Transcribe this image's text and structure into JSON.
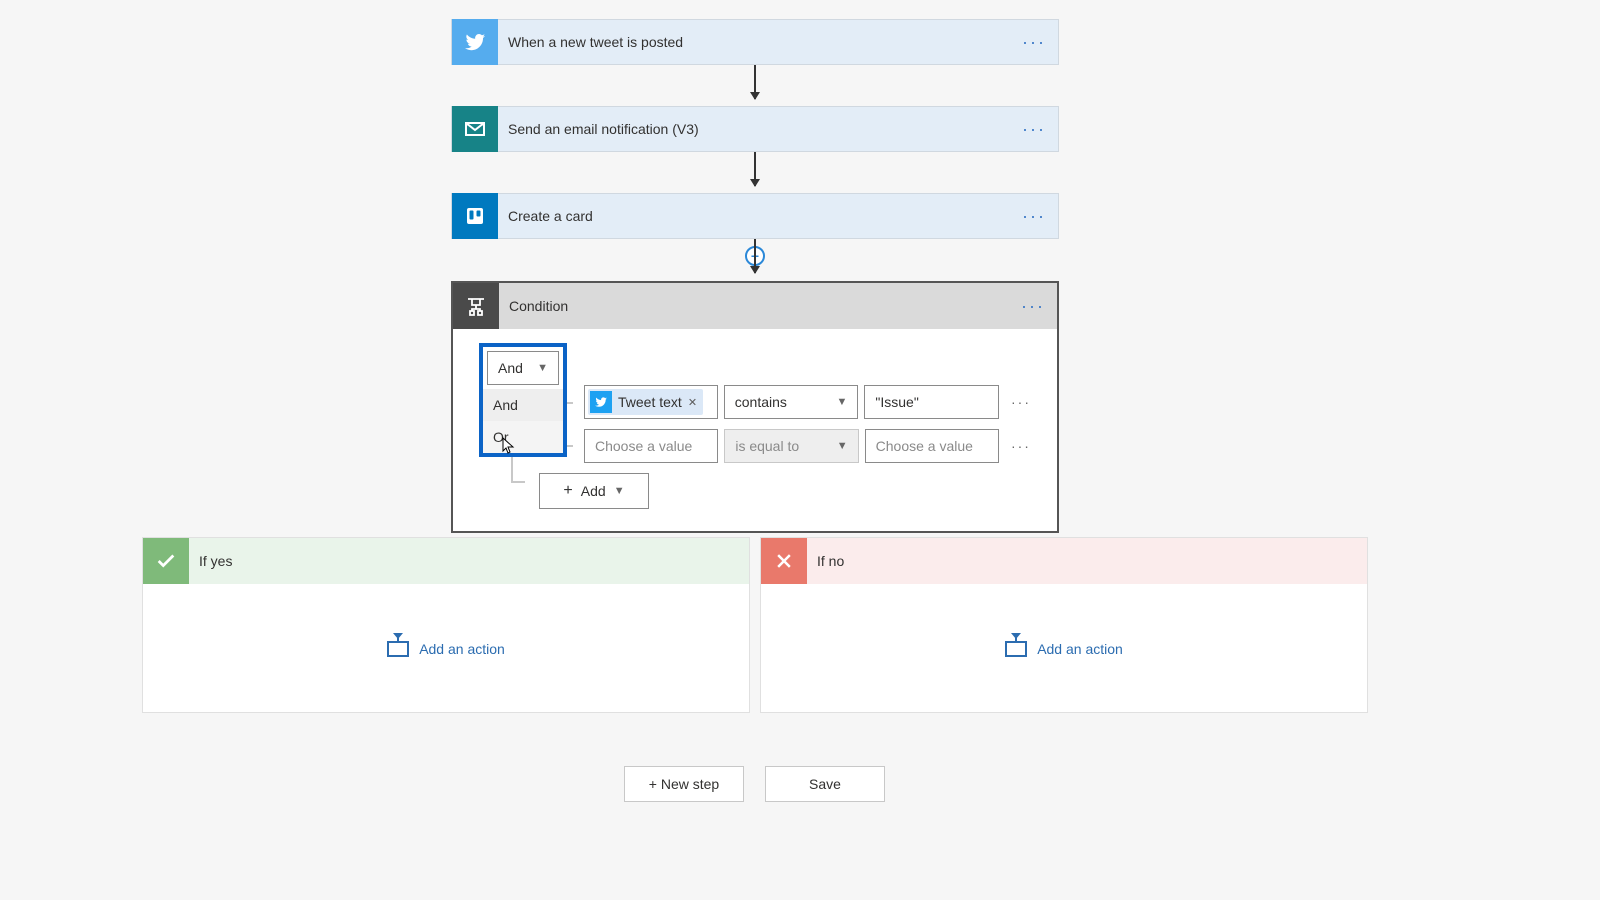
{
  "flow": {
    "card1": {
      "title": "When a new tweet is posted"
    },
    "card2": {
      "title": "Send an email notification (V3)"
    },
    "card3": {
      "title": "Create a card"
    }
  },
  "condition": {
    "title": "Condition",
    "logic_selected": "And",
    "logic_options": {
      "opt1": "And",
      "opt2": "Or"
    },
    "row1": {
      "token": "Tweet text",
      "operator": "contains",
      "value": "\"Issue\""
    },
    "row2": {
      "left_placeholder": "Choose a value",
      "operator": "is equal to",
      "right_placeholder": "Choose a value"
    },
    "add_label": "Add"
  },
  "branch": {
    "yes_title": "If yes",
    "no_title": "If no",
    "add_action": "Add an action"
  },
  "footer": {
    "new_step": "+ New step",
    "save": "Save"
  }
}
